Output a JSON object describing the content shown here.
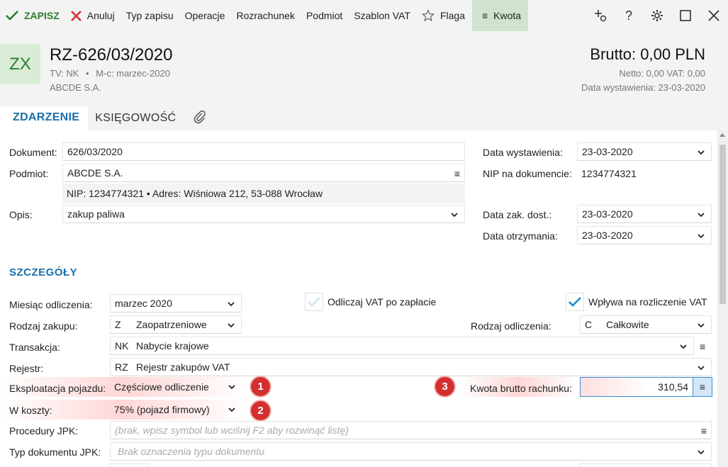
{
  "toolbar": {
    "save_label": "ZAPISZ",
    "cancel_label": "Anuluj",
    "items": [
      "Typ zapisu",
      "Operacje",
      "Rozrachunek",
      "Podmiot",
      "Szablon VAT"
    ],
    "flag_label": "Flaga",
    "amount_label": "Kwota"
  },
  "header": {
    "badge": "ZX",
    "title": "RZ-626/03/2020",
    "meta_tv": "TV: NK",
    "meta_sep": "•",
    "meta_month": "M-c: marzec-2020",
    "company": "ABCDE S.A.",
    "brutto": "Brutto: 0,00 PLN",
    "netto": "Netto: 0,00 VAT: 0,00",
    "issue_date": "Data wystawienia: 23-03-2020"
  },
  "tabs": {
    "zdarzenie": "ZDARZENIE",
    "ksiegowosc": "KSIĘGOWOŚĆ"
  },
  "form": {
    "dokument_label": "Dokument:",
    "dokument_value": "626/03/2020",
    "podmiot_label": "Podmiot:",
    "podmiot_value": "ABCDE S.A.",
    "nip_info": "NIP:  1234774321  •  Adres:  Wiśniowa 212, 53-088 Wrocław",
    "opis_label": "Opis:",
    "opis_value": "zakup paliwa",
    "data_wyst_label": "Data wystawienia:",
    "data_wyst_value": "23-03-2020",
    "nip_dok_label": "NIP na dokumencie:",
    "nip_dok_value": "1234774321",
    "data_zak_label": "Data zak. dost.:",
    "data_zak_value": "23-03-2020",
    "data_otrz_label": "Data otrzymania:",
    "data_otrz_value": "23-03-2020"
  },
  "details": {
    "section_title": "SZCZEGÓŁY",
    "miesiac_label": "Miesiąc odliczenia:",
    "miesiac_value": "marzec 2020",
    "odliczaj_label": "Odliczaj VAT po zapłacie",
    "odliczaj_checked": false,
    "wplywa_label": "Wpływa na rozliczenie VAT",
    "wplywa_checked": true,
    "rodzaj_zakupu_label": "Rodzaj zakupu:",
    "rodzaj_zakupu_code": "Z",
    "rodzaj_zakupu_value": "Zaopatrzeniowe",
    "rodzaj_odl_label": "Rodzaj odliczenia:",
    "rodzaj_odl_code": "C",
    "rodzaj_odl_value": "Całkowite",
    "transakcja_label": "Transakcja:",
    "transakcja_code": "NK",
    "transakcja_value": "Nabycie krajowe",
    "rejestr_label": "Rejestr:",
    "rejestr_code": "RZ",
    "rejestr_value": "Rejestr zakupów VAT",
    "eksploatacja_label": "Eksploatacja pojazdu:",
    "eksploatacja_value": "Częściowe odliczenie",
    "koszty_label": "W koszty:",
    "koszty_value": "75% (pojazd firmowy)",
    "kwota_label": "Kwota brutto rachunku:",
    "kwota_value": "310,54",
    "procedury_label": "Procedury JPK:",
    "procedury_placeholder": "(brak, wpisz symbol lub wciśnij F2 aby rozwinąć listę)",
    "typ_jpk_label": "Typ dokumentu JPK:",
    "typ_jpk_placeholder": "Brak oznaczenia typu dokumentu"
  },
  "annotations": [
    "1",
    "2",
    "3"
  ],
  "colors": {
    "accent": "#1a6fa8",
    "save_green": "#2e7d32",
    "cancel_red": "#d32f2f",
    "badge_red": "#d32f2f",
    "active_tab_bg": "#cfe3cf"
  }
}
